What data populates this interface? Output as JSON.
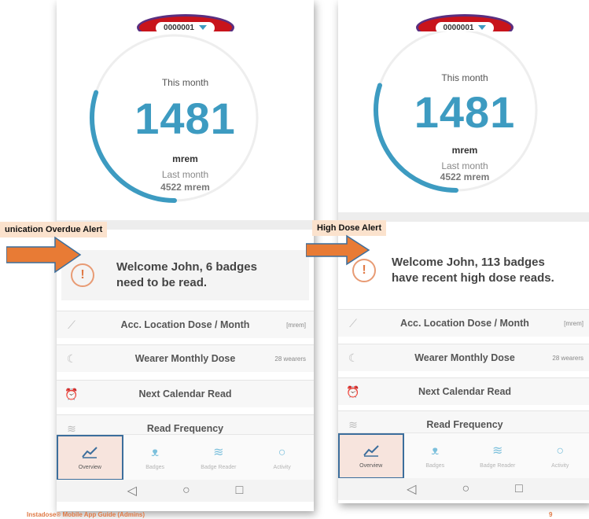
{
  "screens": [
    {
      "device_id": "0000001",
      "gauge": {
        "this_month_label": "This month",
        "value": "1481",
        "unit": "mrem",
        "last_month_label": "Last month",
        "last_month_value": "4522 mrem",
        "progress_fraction": 0.3
      },
      "alert": {
        "line1": "Welcome John, 6 badges",
        "line2": "need to be read.",
        "icon": "!"
      },
      "rows": [
        {
          "label": "Acc. Location Dose / Month",
          "meta": "[mrem]",
          "icon": "trend-icon"
        },
        {
          "label": "Wearer Monthly Dose",
          "meta": "28 wearers",
          "icon": "moon-icon"
        },
        {
          "label": "Next Calendar Read",
          "meta": "",
          "icon": "alarm-clock-icon"
        },
        {
          "label": "Read Frequency",
          "meta": "",
          "icon": "wifi-icon"
        }
      ],
      "nav": [
        {
          "label": "Overview",
          "icon": "chart-line-icon",
          "active": true
        },
        {
          "label": "Badges",
          "icon": "badges-icon",
          "active": false
        },
        {
          "label": "Badge Reader",
          "icon": "wifi-icon",
          "active": false
        },
        {
          "label": "Activity",
          "icon": "speech-icon",
          "active": false
        }
      ]
    },
    {
      "device_id": "0000001",
      "gauge": {
        "this_month_label": "This month",
        "value": "1481",
        "unit": "mrem",
        "last_month_label": "Last month",
        "last_month_value": "4522 mrem",
        "progress_fraction": 0.3
      },
      "alert": {
        "line1": "Welcome John, 113 badges",
        "line2": "have recent high dose reads.",
        "icon": "!"
      },
      "rows": [
        {
          "label": "Acc. Location Dose / Month",
          "meta": "[mrem]",
          "icon": "trend-icon"
        },
        {
          "label": "Wearer Monthly Dose",
          "meta": "28 wearers",
          "icon": "moon-icon"
        },
        {
          "label": "Next Calendar Read",
          "meta": "",
          "icon": "alarm-clock-icon"
        },
        {
          "label": "Read Frequency",
          "meta": "",
          "icon": "wifi-icon"
        }
      ],
      "nav": [
        {
          "label": "Overview",
          "icon": "chart-line-icon",
          "active": true
        },
        {
          "label": "Badges",
          "icon": "badges-icon",
          "active": false
        },
        {
          "label": "Badge Reader",
          "icon": "wifi-icon",
          "active": false
        },
        {
          "label": "Activity",
          "icon": "speech-icon",
          "active": false
        }
      ]
    }
  ],
  "annotations": {
    "left_callout": "unication Overdue Alert",
    "right_callout": "High Dose Alert"
  },
  "footer": {
    "guide_title": "Instadose® Mobile App Guide (Admins)",
    "page_number": "9"
  },
  "colors": {
    "accent_blue": "#3d9bc1",
    "alert_orange": "#e07a46",
    "highlight_red": "#c8141b",
    "callout_arrow": "#e87b35"
  }
}
